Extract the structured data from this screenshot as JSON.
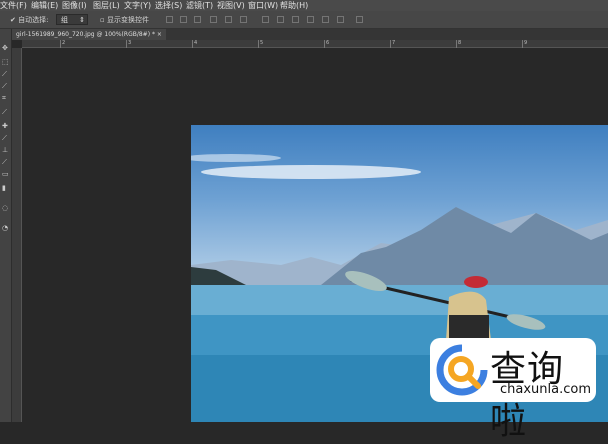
{
  "menu": [
    "文件(F)",
    "编辑(E)",
    "图像(I)",
    "图层(L)",
    "文字(Y)",
    "选择(S)",
    "滤镜(T)",
    "视图(V)",
    "窗口(W)",
    "帮助(H)"
  ],
  "options": {
    "auto_select": "自动选择:",
    "auto_select_value": "组",
    "show_transform": "显示变换控件"
  },
  "document_tab": {
    "title": "girl-1561989_960_720.jpg @ 100%(RGB/8#) *",
    "close": "×"
  },
  "ruler_ticks": [
    "2",
    "3",
    "4",
    "5",
    "6",
    "7",
    "8",
    "9"
  ],
  "watermark": {
    "brand_cn": "查询啦",
    "brand_url": "chaxunla.com"
  }
}
